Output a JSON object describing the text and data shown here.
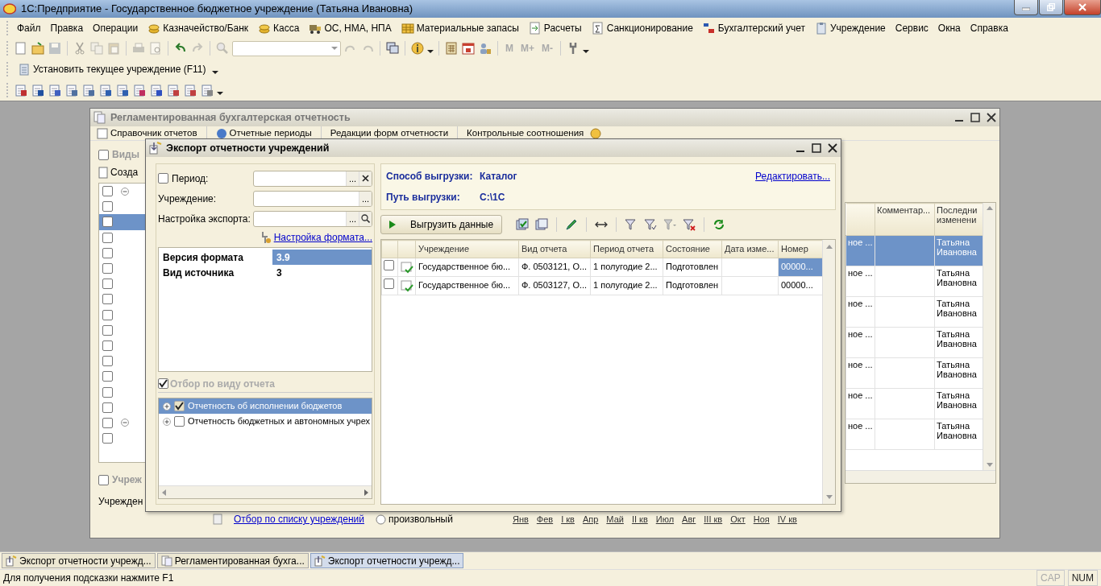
{
  "window": {
    "title": "1С:Предприятие - Государственное бюджетное учреждение  (Татьяна Ивановна)"
  },
  "menu": [
    {
      "label": "Файл"
    },
    {
      "label": "Правка"
    },
    {
      "label": "Операции"
    },
    {
      "label": "Казначейство/Банк"
    },
    {
      "label": "Касса"
    },
    {
      "label": "ОС, НМА, НПА"
    },
    {
      "label": "Материальные запасы"
    },
    {
      "label": "Расчеты"
    },
    {
      "label": "Санкционирование"
    },
    {
      "label": "Бухгалтерский учет"
    },
    {
      "label": "Учреждение"
    },
    {
      "label": "Сервис"
    },
    {
      "label": "Окна"
    },
    {
      "label": "Справка"
    }
  ],
  "memory_buttons": [
    "M",
    "M+",
    "M-"
  ],
  "set_institution_button": "Установить текущее учреждение (F11)",
  "background_window": {
    "title": "Регламентированная бухгалтерская отчетность",
    "toolbar": [
      "Справочник отчетов",
      "Отчетные периоды",
      "Редакции форм отчетности",
      "Контрольные соотношения"
    ],
    "types_group": {
      "label": "Виды",
      "checked": false
    },
    "create_button": "Созда",
    "list_rows": [
      {
        "checked": false,
        "selected": false,
        "expandable": true
      },
      {
        "checked": false,
        "selected": false,
        "expandable": false
      },
      {
        "checked": false,
        "selected": true,
        "expandable": false
      },
      {
        "checked": false,
        "selected": false,
        "expandable": false
      },
      {
        "checked": false,
        "selected": false,
        "expandable": false
      },
      {
        "checked": false,
        "selected": false,
        "expandable": false
      },
      {
        "checked": false,
        "selected": false,
        "expandable": false
      },
      {
        "checked": false,
        "selected": false,
        "expandable": false
      },
      {
        "checked": false,
        "selected": false,
        "expandable": false
      },
      {
        "checked": false,
        "selected": false,
        "expandable": false
      },
      {
        "checked": false,
        "selected": false,
        "expandable": false
      },
      {
        "checked": false,
        "selected": false,
        "expandable": false
      },
      {
        "checked": false,
        "selected": false,
        "expandable": false
      },
      {
        "checked": false,
        "selected": false,
        "expandable": false
      },
      {
        "checked": false,
        "selected": false,
        "expandable": false
      },
      {
        "checked": false,
        "selected": false,
        "expandable": true
      },
      {
        "checked": false,
        "selected": false,
        "expandable": false
      }
    ],
    "institutions_group": {
      "label": "Учреж",
      "checked": false
    },
    "institution_label": "Учрежден",
    "table": {
      "columns": [
        "Комментар...",
        "Последни изменени"
      ],
      "rows": [
        {
          "selected": true,
          "cells": [
            "ное ...",
            "",
            "Татьяна Ивановна"
          ]
        },
        {
          "selected": false,
          "cells": [
            "ное ...",
            "",
            "Татьяна Ивановна"
          ]
        },
        {
          "selected": false,
          "cells": [
            "ное ...",
            "",
            "Татьяна Ивановна"
          ]
        },
        {
          "selected": false,
          "cells": [
            "ное ...",
            "",
            "Татьяна Ивановна"
          ]
        },
        {
          "selected": false,
          "cells": [
            "ное ...",
            "",
            "Татьяна Ивановна"
          ]
        },
        {
          "selected": false,
          "cells": [
            "ное ...",
            "",
            "Татьяна Ивановна"
          ]
        },
        {
          "selected": false,
          "cells": [
            "ное ...",
            "",
            "Татьяна Ивановна"
          ]
        }
      ]
    },
    "filter_link": "Отбор по списку учреждений",
    "custom_radio": {
      "label": "произвольный",
      "selected": false
    },
    "periods": [
      "Янв",
      "Фев",
      "I кв",
      "Апр",
      "Май",
      "II кв",
      "Июл",
      "Авг",
      "III кв",
      "Окт",
      "Ноя",
      "IV кв"
    ]
  },
  "dialog": {
    "title": "Экспорт отчетности учреждений",
    "period": {
      "label": "Период:",
      "checked": false,
      "button": "..."
    },
    "institution": {
      "label": "Учреждение:",
      "button": "..."
    },
    "export_setting": {
      "label": "Настройка экспорта:",
      "button": "..."
    },
    "format_link": "Настройка формата...",
    "properties": [
      {
        "name": "Версия формата",
        "value": "3.9",
        "selected": true
      },
      {
        "name": "Вид источника",
        "value": "3",
        "selected": false
      }
    ],
    "report_filter": {
      "label": "Отбор по виду отчета",
      "checked": true
    },
    "report_types": [
      {
        "label": "Отчетность об исполнении бюджетов",
        "checked": true,
        "selected": true
      },
      {
        "label": "Отчетность бюджетных и автономных учрех",
        "checked": false,
        "selected": false
      }
    ],
    "export_method": {
      "label": "Способ выгрузки:",
      "value": "Каталог"
    },
    "export_path": {
      "label": "Путь выгрузки:",
      "value": "C:\\1C"
    },
    "edit_link": "Редактировать...",
    "export_button": "Выгрузить данные",
    "table": {
      "columns": [
        "Учреждение",
        "Вид отчета",
        "Период отчета",
        "Состояние",
        "Дата изме...",
        "Номер"
      ],
      "rows": [
        {
          "checked": false,
          "selected": true,
          "cells": [
            "Государственное бю...",
            "Ф. 0503121, О...",
            "1 полугодие 2...",
            "Подготовлен",
            "",
            "00000..."
          ]
        },
        {
          "checked": false,
          "selected": false,
          "cells": [
            "Государственное бю...",
            "Ф. 0503127, О...",
            "1 полугодие 2...",
            "Подготовлен",
            "",
            "00000..."
          ]
        }
      ]
    }
  },
  "taskbar": [
    {
      "label": "Экспорт отчетности учрежд...",
      "selected": false
    },
    {
      "label": "Регламентированная бухга...",
      "selected": false
    },
    {
      "label": "Экспорт отчетности учрежд...",
      "selected": true
    }
  ],
  "status_bar": {
    "hint": "Для получения подсказки нажмите F1",
    "indicators": [
      {
        "label": "CAP",
        "on": false
      },
      {
        "label": "NUM",
        "on": true
      }
    ]
  }
}
